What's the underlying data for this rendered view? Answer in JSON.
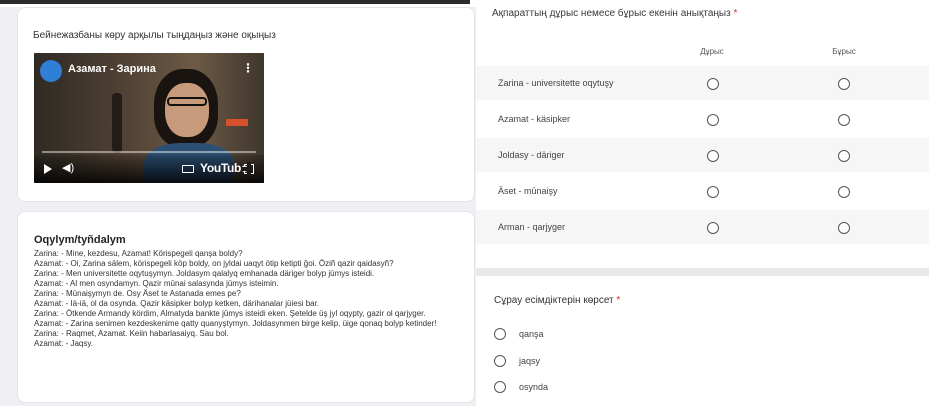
{
  "video_card": {
    "heading": "Бейнежазбаны көру арқылы тыңдаңыз және оқыңыз",
    "video": {
      "title": "Азамат - Зарина",
      "platform_label": "YouTube",
      "icons": [
        "menu-kebab-icon",
        "play-icon",
        "volume-icon",
        "captions-icon",
        "fullscreen-icon"
      ]
    }
  },
  "text_card": {
    "title": "Oqylym/tyñdalym",
    "lines": [
      "Zarina: - Mine, kezdesu, Azamat! Körіspegeli qanşa boldy?",
      "Azamat: - Oi, Zarina sälem, körіspegeli köp boldy, on jyldai uaqyt ötip ketipti ğoi. Özіñ qazir qaidasyñ?",
      "Zarina: - Men universitette oqytuşymyn. Joldasym qalalyq emhanada däriger bolyp jūmys isteidі.",
      "Azamat: - Al men osyndamyn. Qazir mūnai salasynda jūmys isteimin.",
      "Zarina: - Mūnaişymyn de. Osy Äset te Astanada emes pe?",
      "Azamat: - Iä-iä, ol da osynda. Qazir käsipker bolyp ketken, därіhanalar jüiesi bar.",
      "Zarina: - Ötkende Armandy kördіm, Almatyda bankte jūmys isteidі eken. Şetelde üş jyl oqypty, gazir ol qarjyger.",
      "Azamat: - Zarina senimen kezdeskenime qatty quanyştymyn. Joldasynmen birge kelip, üige qonaq bolyp ketinder!",
      "Zarina: - Raqmet, Azamat. Keiin habarlasaiyq. Sau bol.",
      "Azamat: - Jaqsy."
    ]
  },
  "grid_question": {
    "question": "Ақпараттың дұрыс немесе бұрыс екенін анықтаңыз",
    "required_mark": "*",
    "columns": [
      "Дұрыс",
      "Бұрыс"
    ],
    "rows": [
      "Zarina - universitette oqytuşy",
      "Azamat - käsipker",
      "Joldasy - däriger",
      "Äset - mūnaişy",
      "Arman - qarjyger"
    ]
  },
  "mc_question": {
    "question": "Сұрау есімдіктерін көрсет",
    "required_mark": "*",
    "options": [
      "qanşa",
      "jaqsy",
      "osynda"
    ]
  },
  "colors": {
    "required": "#d93025",
    "page_background": "#f0f0f4",
    "card_background": "#ffffff"
  }
}
